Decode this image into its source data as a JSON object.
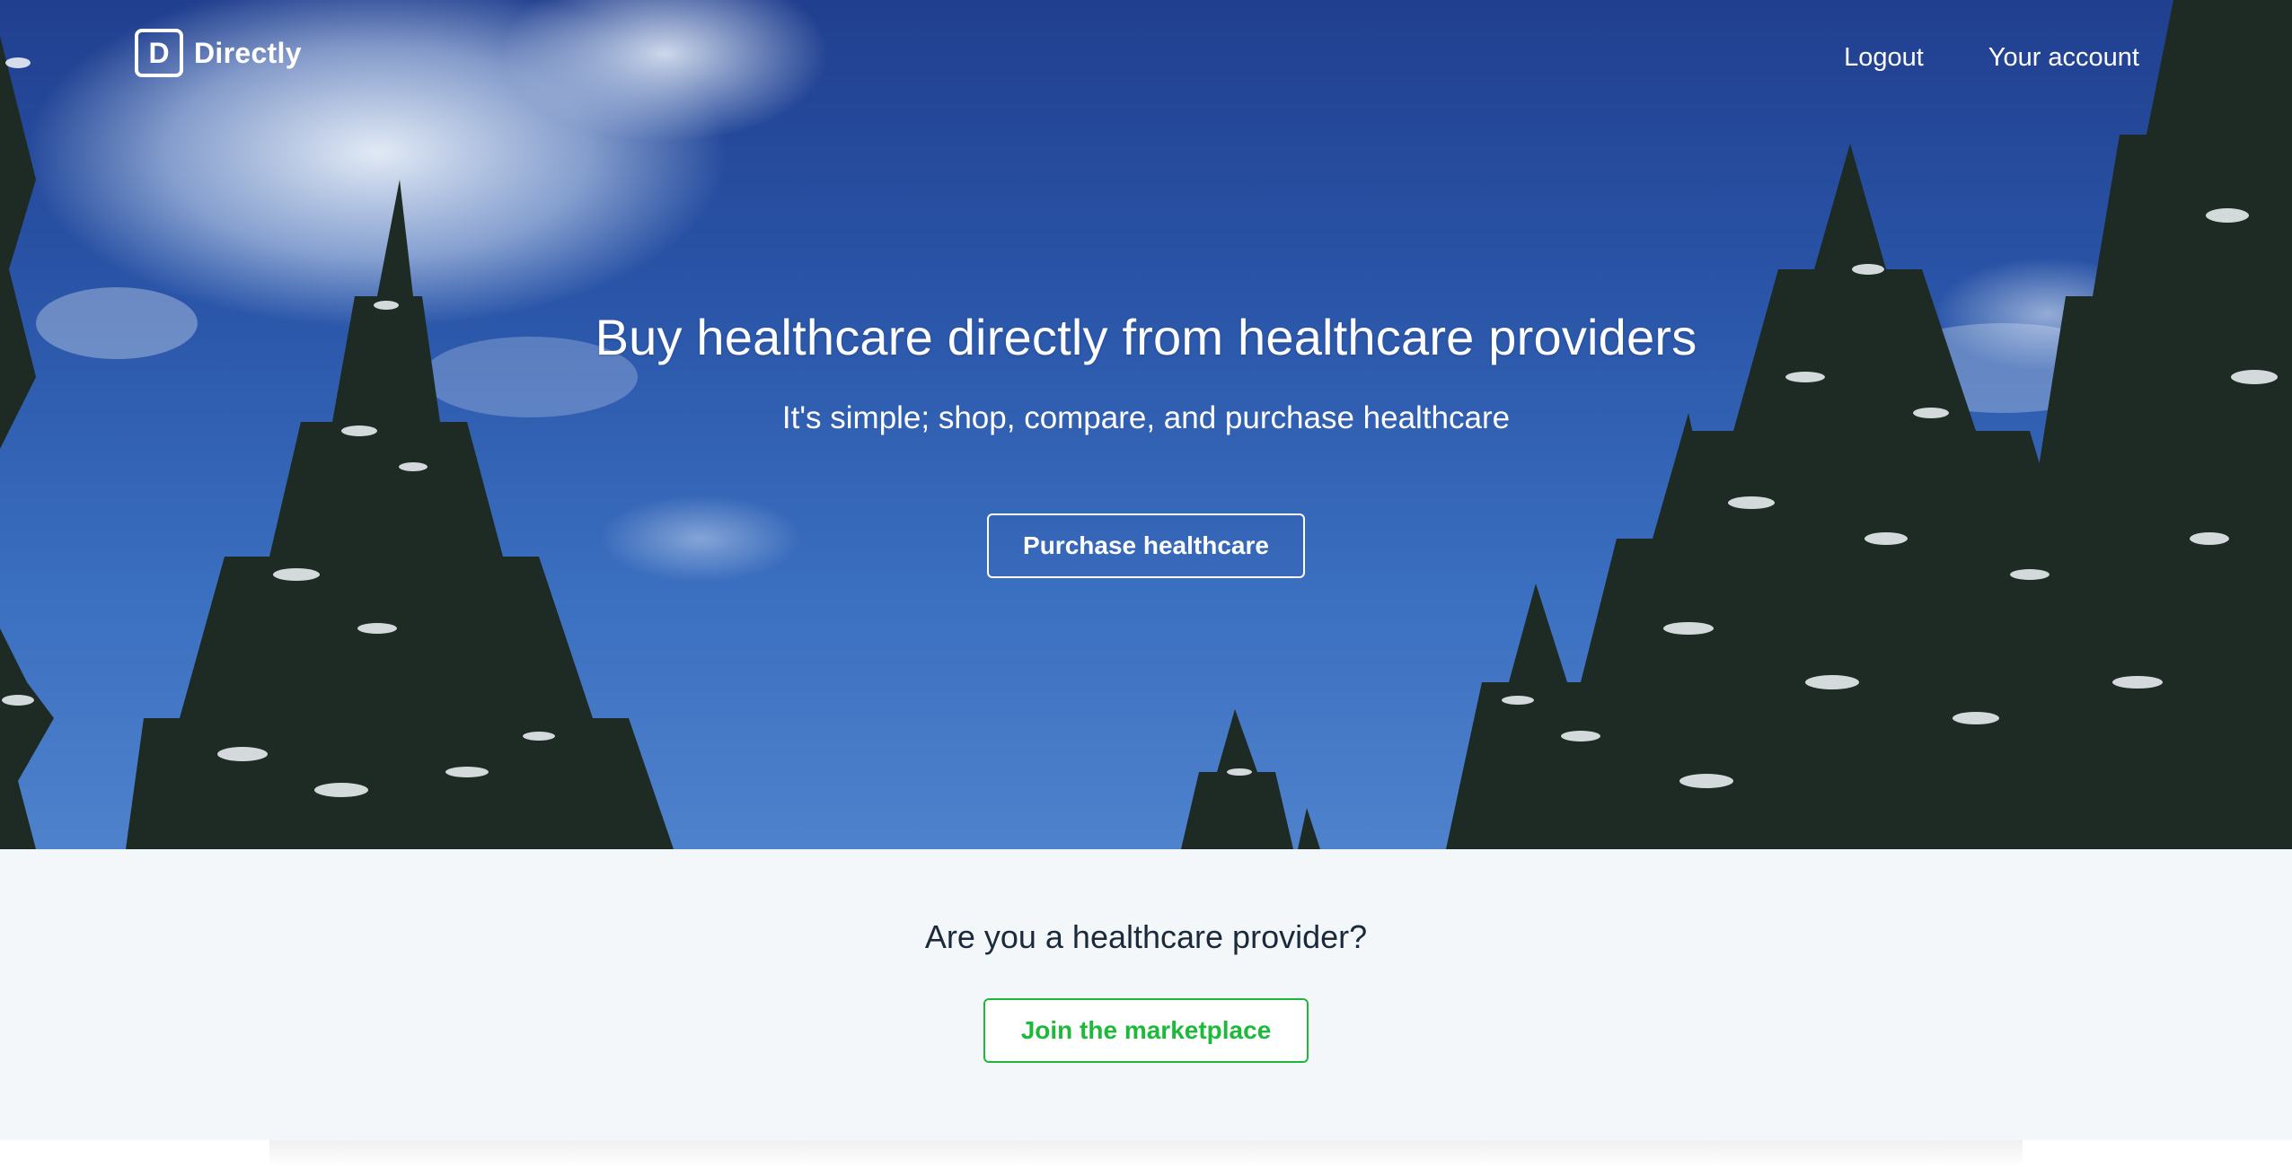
{
  "brand": {
    "logo_letter": "D",
    "name": "Directly"
  },
  "nav": {
    "links": [
      {
        "label": "Logout"
      },
      {
        "label": "Your account"
      }
    ]
  },
  "hero": {
    "title": "Buy healthcare directly from healthcare providers",
    "subtitle": "It's simple; shop, compare, and purchase healthcare",
    "cta_label": "Purchase healthcare",
    "background_description_icon": "snowy-pine-trees-sky-image"
  },
  "provider": {
    "title": "Are you a healthcare provider?",
    "cta_label": "Join the marketplace"
  },
  "colors": {
    "sky_top": "#213f8f",
    "sky_bottom": "#4f82cc",
    "accent_green": "#1db93a",
    "section_bg": "#f4f7fa",
    "text_dark": "#1b2a3a"
  }
}
